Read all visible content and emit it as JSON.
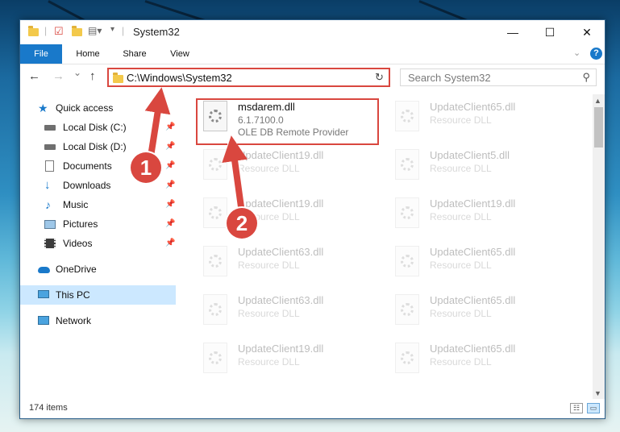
{
  "window": {
    "title": "System32",
    "controls": {
      "minimize": "—",
      "maximize": "☐",
      "close": "✕"
    }
  },
  "ribbon": {
    "tabs": [
      {
        "label": "File",
        "active": true
      },
      {
        "label": "Home"
      },
      {
        "label": "Share"
      },
      {
        "label": "View"
      }
    ]
  },
  "navbar": {
    "back": "←",
    "forward": "→",
    "recent": "⌄",
    "up": "↑",
    "address": "C:\\Windows\\System32",
    "refresh": "↻",
    "search_placeholder": "Search System32"
  },
  "sidebar": {
    "items": [
      {
        "label": "Quick access",
        "icon": "star-icon",
        "pinned": false
      },
      {
        "label": "Local Disk (C:)",
        "icon": "drive-icon",
        "pinned": true
      },
      {
        "label": "Local Disk (D:)",
        "icon": "drive-icon",
        "pinned": true
      },
      {
        "label": "Documents",
        "icon": "documents-icon",
        "pinned": true
      },
      {
        "label": "Downloads",
        "icon": "downloads-icon",
        "pinned": true
      },
      {
        "label": "Music",
        "icon": "music-icon",
        "pinned": true
      },
      {
        "label": "Pictures",
        "icon": "pictures-icon",
        "pinned": true
      },
      {
        "label": "Videos",
        "icon": "videos-icon",
        "pinned": true
      },
      {
        "label": "OneDrive",
        "icon": "onedrive-icon",
        "pinned": false
      },
      {
        "label": "This PC",
        "icon": "this-pc-icon",
        "pinned": false,
        "selected": true
      },
      {
        "label": "Network",
        "icon": "network-icon",
        "pinned": false
      }
    ]
  },
  "files": {
    "highlighted": {
      "name": "msdarem.dll",
      "version": "6.1.7100.0",
      "description": "OLE DB Remote Provider"
    },
    "others": [
      {
        "name": "UpdateClient65.dll",
        "type": "Resource DLL"
      },
      {
        "name": "UpdateClient19.dll",
        "type": "Resource DLL"
      },
      {
        "name": "UpdateClient5.dll",
        "type": "Resource DLL"
      },
      {
        "name": "UpdateClient19.dll",
        "type": "Resource DLL"
      },
      {
        "name": "UpdateClient19.dll",
        "type": "Resource DLL"
      },
      {
        "name": "UpdateClient63.dll",
        "type": "Resource DLL"
      },
      {
        "name": "UpdateClient65.dll",
        "type": "Resource DLL"
      },
      {
        "name": "UpdateClient63.dll",
        "type": "Resource DLL"
      },
      {
        "name": "UpdateClient65.dll",
        "type": "Resource DLL"
      },
      {
        "name": "UpdateClient19.dll",
        "type": "Resource DLL"
      },
      {
        "name": "UpdateClient65.dll",
        "type": "Resource DLL"
      }
    ]
  },
  "status": {
    "item_count": "174 items"
  },
  "annotations": {
    "callout_1": "1",
    "callout_2": "2",
    "color": "#d9473f"
  },
  "colors": {
    "accent": "#1979ca",
    "selection": "#cce8ff",
    "highlight": "#d9473f"
  }
}
